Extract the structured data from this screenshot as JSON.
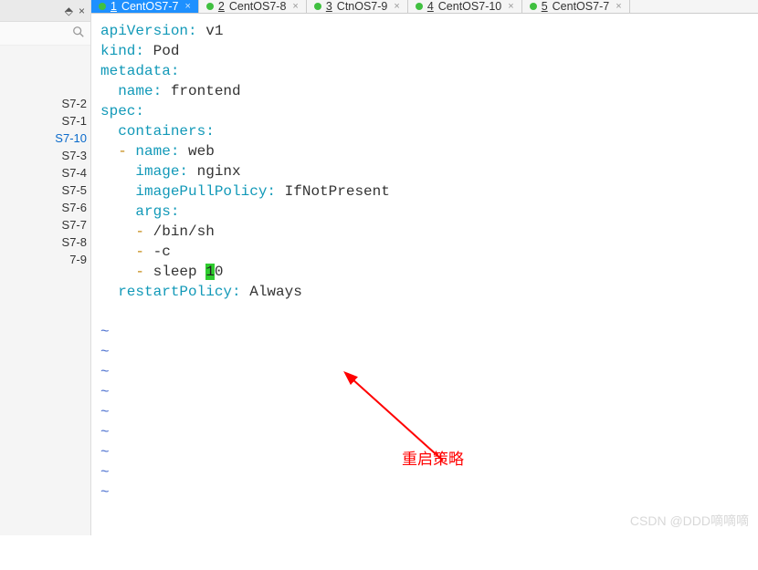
{
  "sidebar": {
    "items": [
      {
        "label": "S7-2"
      },
      {
        "label": "S7-1"
      },
      {
        "label": "S7-10",
        "selected": true
      },
      {
        "label": "S7-3"
      },
      {
        "label": "S7-4"
      },
      {
        "label": "S7-5"
      },
      {
        "label": "S7-6"
      },
      {
        "label": "S7-7"
      },
      {
        "label": "S7-8"
      },
      {
        "label": "7-9"
      }
    ]
  },
  "tabs": [
    {
      "num": "1",
      "label": "CentOS7-7",
      "active": true
    },
    {
      "num": "2",
      "label": "CentOS7-8"
    },
    {
      "num": "3",
      "label": "CtnOS7-9"
    },
    {
      "num": "4",
      "label": "CentOS7-10"
    },
    {
      "num": "5",
      "label": "CentOS7-7"
    }
  ],
  "code": {
    "l1k": "apiVersion:",
    "l1v": " v1",
    "l2k": "kind:",
    "l2v": " Pod",
    "l3k": "metadata:",
    "l4k": "  name:",
    "l4v": " frontend",
    "l5k": "spec:",
    "l6k": "  containers:",
    "l7d": "  - ",
    "l7k": "name:",
    "l7v": " web",
    "l8k": "    image:",
    "l8v": " nginx",
    "l9k": "    imagePullPolicy:",
    "l9v": " IfNotPresent",
    "l10k": "    args:",
    "l11d": "    - ",
    "l11v": "/bin/sh",
    "l12d": "    - ",
    "l12v": "-c",
    "l13d": "    - ",
    "l13v1": "sleep ",
    "l13hl": "1",
    "l13v2": "0",
    "l14k": "  restartPolicy:",
    "l14v": " Always",
    "tilde": "~"
  },
  "annotation": "重启策略",
  "watermark": "CSDN @DDD嘀嘀嘀"
}
